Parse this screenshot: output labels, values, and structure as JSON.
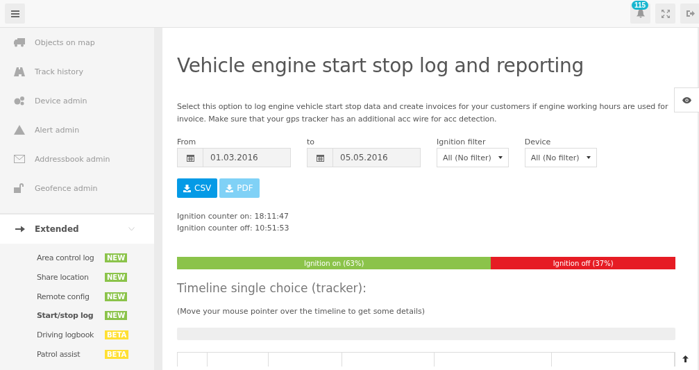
{
  "topbar": {
    "notification_count": "115"
  },
  "sidebar": {
    "items": [
      {
        "label": "Objects on map"
      },
      {
        "label": "Track history"
      },
      {
        "label": "Device admin"
      },
      {
        "label": "Alert admin"
      },
      {
        "label": "Addressbook admin"
      },
      {
        "label": "Geofence admin"
      }
    ],
    "group": {
      "label": "Extended",
      "expanded": true,
      "children": [
        {
          "label": "Area control log",
          "badge": "NEW",
          "kind": "new",
          "selected": false
        },
        {
          "label": "Share location",
          "badge": "NEW",
          "kind": "new",
          "selected": false
        },
        {
          "label": "Remote config",
          "badge": "NEW",
          "kind": "new",
          "selected": false
        },
        {
          "label": "Start/stop log",
          "badge": "NEW",
          "kind": "new",
          "selected": true
        },
        {
          "label": "Driving logbook",
          "badge": "BETA",
          "kind": "beta",
          "selected": false
        },
        {
          "label": "Patrol assist",
          "badge": "BETA",
          "kind": "beta",
          "selected": false
        }
      ]
    }
  },
  "page": {
    "title": "Vehicle engine start stop log and reporting",
    "description": "Select this option to log engine vehicle start stop data and create invoices for your customers if engine working hours are used for invoice. Make sure that your gps tracker has an additional acc wire for acc detection.",
    "filters": [
      {
        "kind": "date",
        "label": "From",
        "value": "01.03.2016"
      },
      {
        "kind": "date",
        "label": "to",
        "value": "05.05.2016"
      },
      {
        "kind": "select",
        "label": "Ignition filter",
        "value": "All (No filter)"
      },
      {
        "kind": "select",
        "label": "Device",
        "value": "All (No filter)"
      }
    ],
    "buttons": [
      {
        "label": "CSV",
        "disabled": false
      },
      {
        "label": "PDF",
        "disabled": true
      }
    ],
    "counters": [
      "Ignition counter on: 18:11:47",
      "Ignition counter off: 10:51:53"
    ],
    "ignition_bar": {
      "level": 0.63,
      "on_label": "Ignition on (63%)",
      "off_label": "Ignition off (37%)"
    },
    "timeline_title": "Timeline single choice (tracker):",
    "timeline_hint": "(Move your mouse pointer over the timeline to get some details)"
  }
}
